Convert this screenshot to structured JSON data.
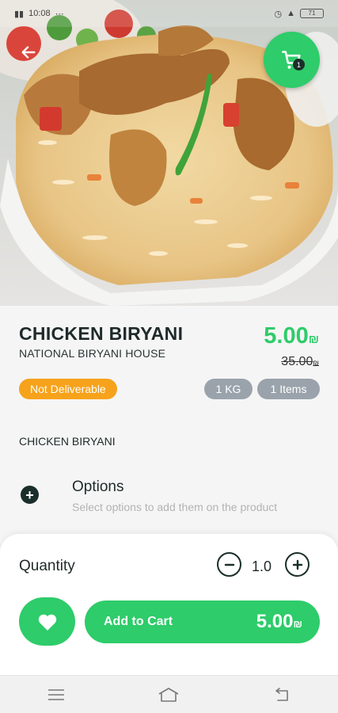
{
  "status_bar": {
    "time": "10:08",
    "battery": "71"
  },
  "product": {
    "name": "CHICKEN BIRYANI",
    "restaurant": "NATIONAL BIRYANI HOUSE",
    "price": "5.00",
    "old_price": "35.00",
    "currency": "₪",
    "availability": "Not Deliverable",
    "weight": "1 KG",
    "items": "1 Items",
    "description": "CHICKEN BIRYANI"
  },
  "cart": {
    "badge_count": "1"
  },
  "options": {
    "title": "Options",
    "subtitle": "Select options to add them on the product"
  },
  "quantity": {
    "label": "Quantity",
    "value": "1.0"
  },
  "actions": {
    "add_to_cart_label": "Add to Cart",
    "total": "5.00"
  },
  "colors": {
    "accent": "#2ecc6a",
    "warning": "#f7a21b",
    "chip": "#9aa3ab",
    "dark": "#1a2e2a"
  },
  "icons": [
    "back-arrow-icon",
    "cart-icon",
    "plus-circle-icon",
    "minus-circle-icon",
    "heart-icon",
    "menu-icon",
    "home-icon",
    "back-icon"
  ]
}
